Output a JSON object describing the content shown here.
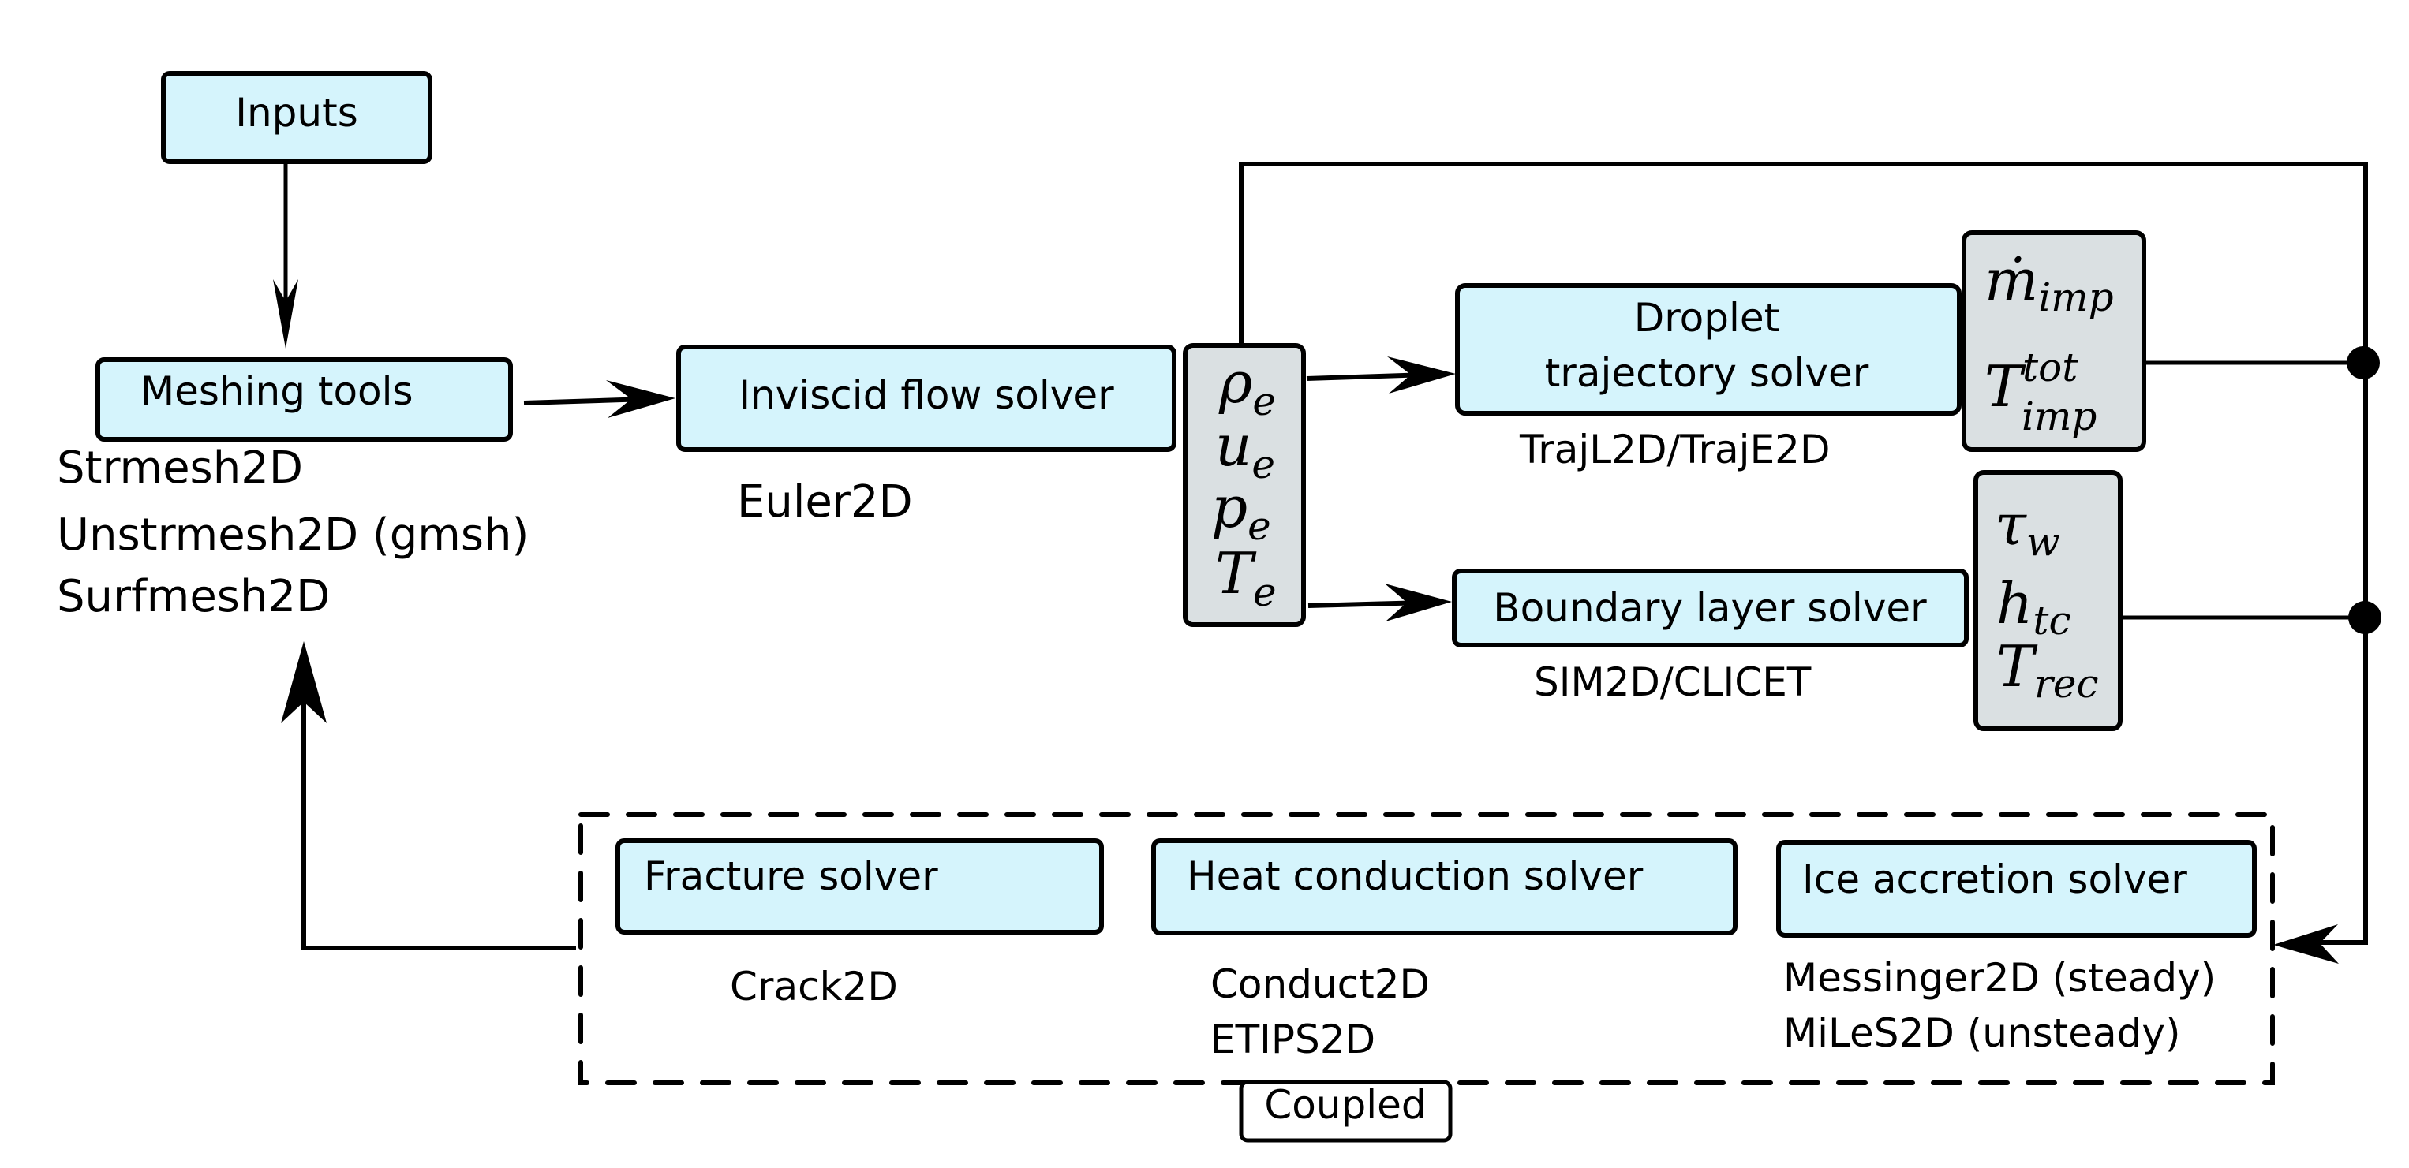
{
  "diagram": {
    "type": "flowchart",
    "colors": {
      "solver_box": "#d5f4fc",
      "variable_box": "#dae0e2",
      "stroke": "#000000"
    },
    "nodes": {
      "inputs": {
        "label": "Inputs"
      },
      "meshing": {
        "label": "Meshing tools",
        "tools": [
          "Strmesh2D",
          "Unstrmesh2D (gmsh)",
          "Surfmesh2D"
        ]
      },
      "inviscid": {
        "label": "Inviscid flow solver",
        "tool": "Euler2D"
      },
      "edge_variables": {
        "items": [
          {
            "symbol": "ρ",
            "sub": "e"
          },
          {
            "symbol": "u",
            "sub": "e"
          },
          {
            "symbol": "p",
            "sub": "e"
          },
          {
            "symbol": "T",
            "sub": "e"
          }
        ]
      },
      "droplet": {
        "label_line1": "Droplet",
        "label_line2": "trajectory solver",
        "tool": "TrajL2D/TrajE2D"
      },
      "droplet_outputs": {
        "items": [
          {
            "symbol": "ṁ",
            "sub": "imp",
            "sup": ""
          },
          {
            "symbol": "T",
            "sub": "imp",
            "sup": "tot"
          }
        ]
      },
      "boundary_layer": {
        "label": "Boundary layer solver",
        "tool": "SIM2D/CLICET"
      },
      "bl_outputs": {
        "items": [
          {
            "symbol": "τ",
            "sub": "w"
          },
          {
            "symbol": "h",
            "sub": "tc"
          },
          {
            "symbol": "T",
            "sub": "rec"
          }
        ]
      },
      "fracture": {
        "label": "Fracture solver",
        "tool": "Crack2D"
      },
      "heat": {
        "label": "Heat conduction solver",
        "tools": [
          "Conduct2D",
          "ETIPS2D"
        ]
      },
      "ice": {
        "label": "Ice accretion solver",
        "tools": [
          "Messinger2D (steady)",
          "MiLeS2D (unsteady)"
        ]
      },
      "coupled_group": {
        "label": "Coupled"
      }
    },
    "edges": [
      {
        "from": "inputs",
        "to": "meshing"
      },
      {
        "from": "meshing",
        "to": "inviscid"
      },
      {
        "from": "edge_variables",
        "to": "droplet"
      },
      {
        "from": "edge_variables",
        "to": "boundary_layer"
      },
      {
        "from": "edge_variables",
        "to": "ice",
        "via": "top-loop"
      },
      {
        "from": "droplet_outputs",
        "to": "ice"
      },
      {
        "from": "bl_outputs",
        "to": "ice"
      },
      {
        "from": "coupled_group",
        "to": "meshing"
      }
    ]
  }
}
